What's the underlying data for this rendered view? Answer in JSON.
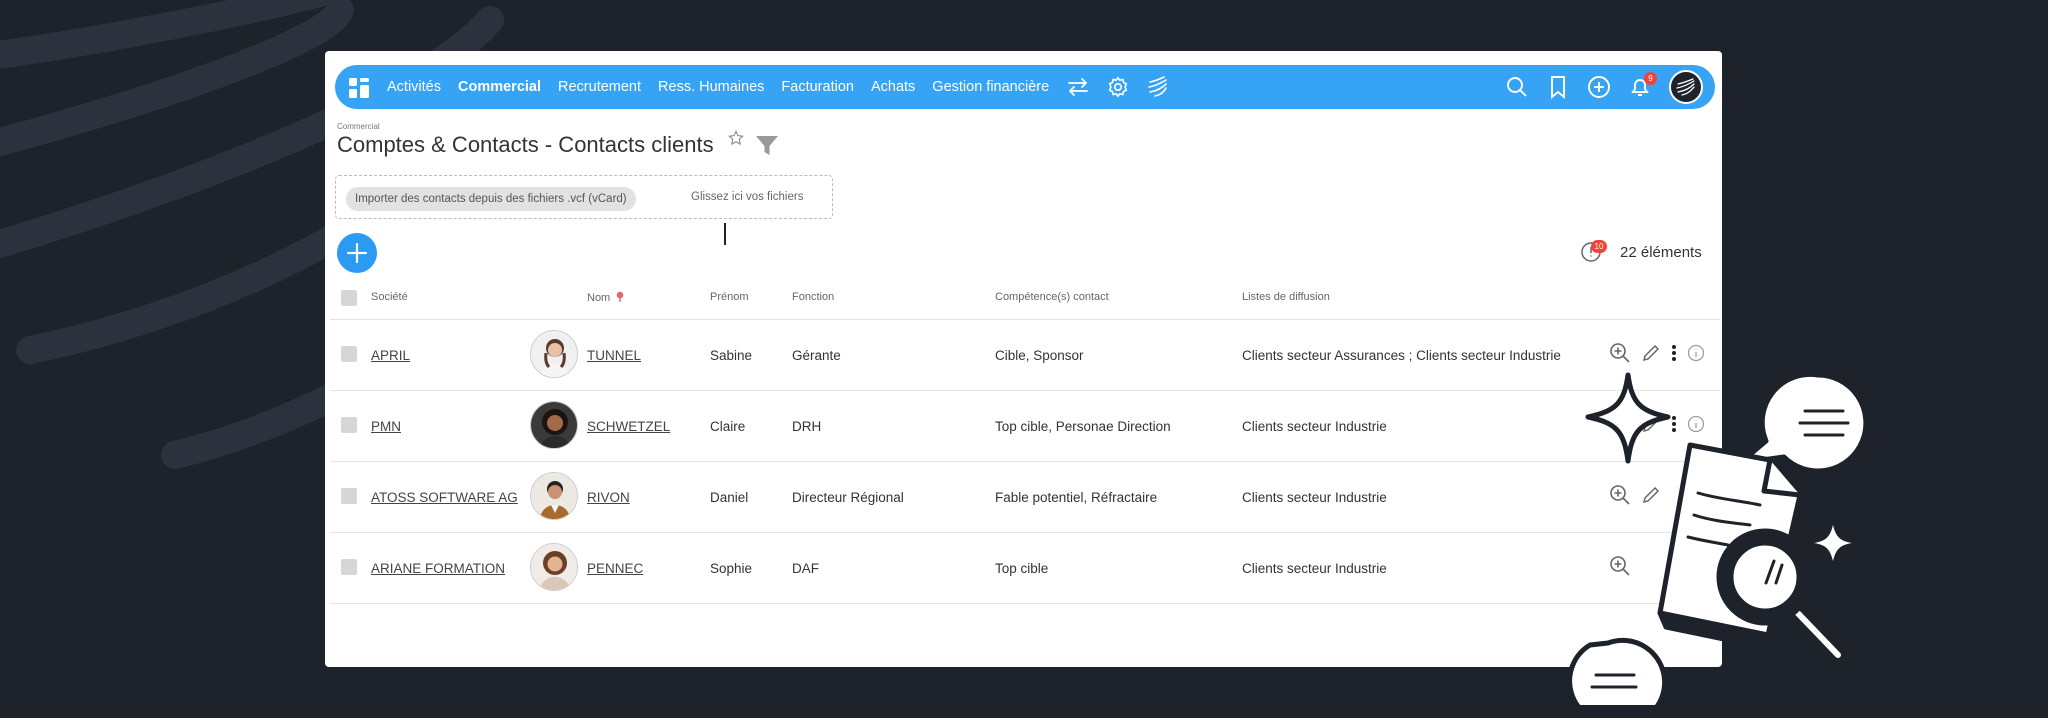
{
  "nav": {
    "items": [
      "Activités",
      "Commercial",
      "Recrutement",
      "Ress. Humaines",
      "Facturation",
      "Achats",
      "Gestion financière"
    ],
    "active": "Commercial",
    "notification_count": "9"
  },
  "page": {
    "breadcrumb": "Commercial",
    "title": "Comptes & Contacts - Contacts clients"
  },
  "import": {
    "button_label": "Importer des contacts depuis des fichiers .vcf (vCard)",
    "drop_text": "Glissez ici vos fichiers"
  },
  "summary": {
    "badge": "10",
    "count_label": "22 éléments"
  },
  "table": {
    "headers": {
      "societe": "Société",
      "nom": "Nom",
      "prenom": "Prénom",
      "fonction": "Fonction",
      "competences": "Compétence(s) contact",
      "listes": "Listes de diffusion"
    },
    "rows": [
      {
        "societe": "APRIL",
        "nom": "TUNNEL",
        "prenom": "Sabine",
        "fonction": "Gérante",
        "competences": "Cible, Sponsor",
        "listes": "Clients secteur Assurances ; Clients secteur Industrie"
      },
      {
        "societe": "PMN",
        "nom": "SCHWETZEL",
        "prenom": "Claire",
        "fonction": "DRH",
        "competences": "Top cible, Personae Direction",
        "listes": "Clients secteur Industrie"
      },
      {
        "societe": "ATOSS SOFTWARE AG",
        "nom": "RIVON",
        "prenom": "Daniel",
        "fonction": "Directeur Régional",
        "competences": "Fable potentiel, Réfractaire",
        "listes": "Clients secteur Industrie"
      },
      {
        "societe": "ARIANE FORMATION",
        "nom": "PENNEC",
        "prenom": "Sophie",
        "fonction": "DAF",
        "competences": "Top cible",
        "listes": "Clients secteur Industrie"
      }
    ]
  },
  "colors": {
    "brand": "#36a3f5",
    "accent": "#2b9af3",
    "background": "#1d222b",
    "badge": "#f04438"
  }
}
